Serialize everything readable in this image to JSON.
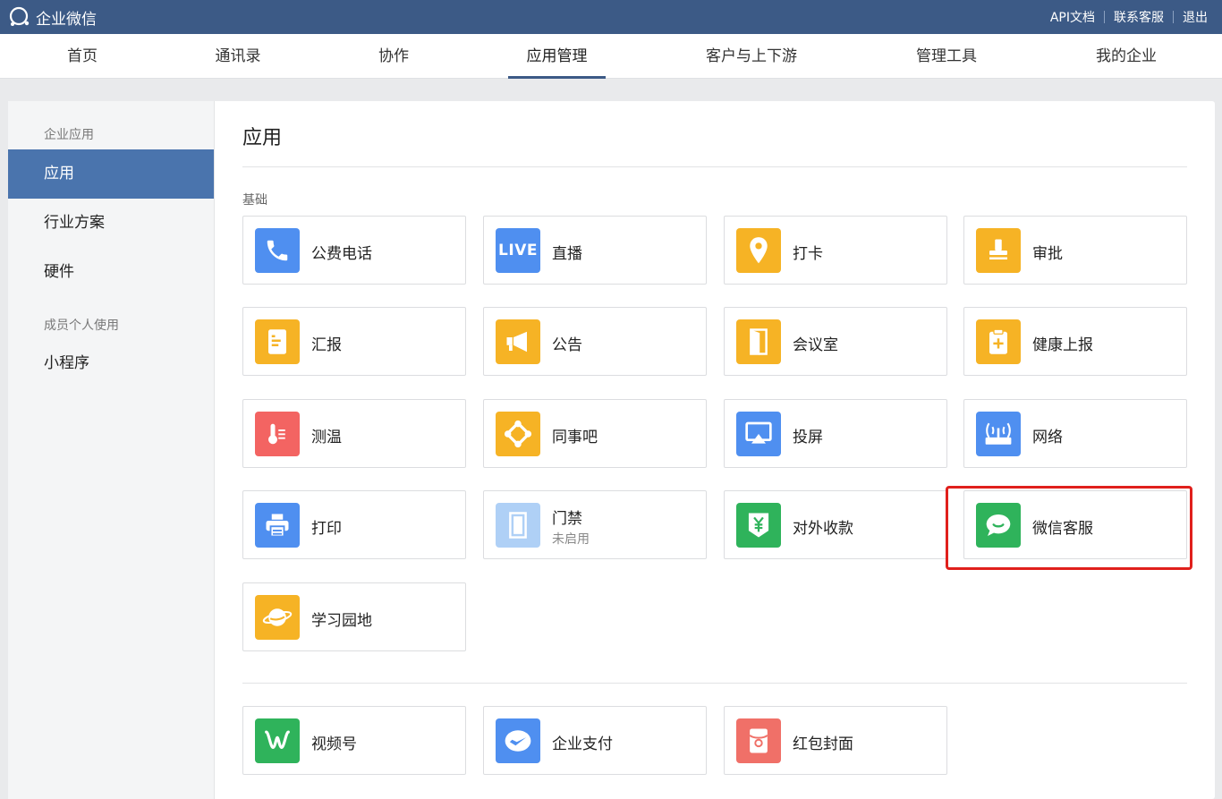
{
  "topbar": {
    "logo_text": "企业微信",
    "links": [
      "API文档",
      "联系客服",
      "退出"
    ]
  },
  "nav": {
    "items": [
      "首页",
      "通讯录",
      "协作",
      "应用管理",
      "客户与上下游",
      "管理工具",
      "我的企业"
    ],
    "active": "应用管理"
  },
  "sidebar": {
    "group1": "企业应用",
    "items1": [
      "应用",
      "行业方案",
      "硬件"
    ],
    "active": "应用",
    "group2": "成员个人使用",
    "items2": [
      "小程序"
    ]
  },
  "main": {
    "title": "应用",
    "section_label": "基础",
    "apps": [
      {
        "name": "公费电话",
        "icon": "phone-icon",
        "color": "#4f8ff0"
      },
      {
        "name": "直播",
        "icon": "live-icon",
        "color": "#4f8ff0"
      },
      {
        "name": "打卡",
        "icon": "location-pin-icon",
        "color": "#f6b325"
      },
      {
        "name": "审批",
        "icon": "stamp-icon",
        "color": "#f6b325"
      },
      {
        "name": "汇报",
        "icon": "report-doc-icon",
        "color": "#f6b325"
      },
      {
        "name": "公告",
        "icon": "megaphone-icon",
        "color": "#f6b325"
      },
      {
        "name": "会议室",
        "icon": "door-icon",
        "color": "#f6b325"
      },
      {
        "name": "健康上报",
        "icon": "health-clipboard-icon",
        "color": "#f6b325"
      },
      {
        "name": "测温",
        "icon": "thermometer-icon",
        "color": "#f36462"
      },
      {
        "name": "同事吧",
        "icon": "network-nodes-icon",
        "color": "#f6b325"
      },
      {
        "name": "投屏",
        "icon": "screencast-icon",
        "color": "#4f8ff0"
      },
      {
        "name": "网络",
        "icon": "router-icon",
        "color": "#4f8ff0"
      },
      {
        "name": "打印",
        "icon": "printer-icon",
        "color": "#4f8ff0"
      },
      {
        "name": "门禁",
        "sub": "未启用",
        "icon": "access-door-icon",
        "color": "#afd0f6"
      },
      {
        "name": "对外收款",
        "icon": "yuan-shield-icon",
        "color": "#2fb35b"
      },
      {
        "name": "微信客服",
        "icon": "chat-bubble-icon",
        "color": "#2fb35b",
        "highlighted": true
      },
      {
        "name": "学习园地",
        "icon": "planet-icon",
        "color": "#f6b325"
      }
    ],
    "apps2": [
      {
        "name": "视频号",
        "icon": "channels-icon",
        "color": "#2fb35b"
      },
      {
        "name": "企业支付",
        "icon": "pay-wing-icon",
        "color": "#4f8ff0"
      },
      {
        "name": "红包封面",
        "icon": "red-envelope-icon",
        "color": "#f07068"
      }
    ]
  }
}
